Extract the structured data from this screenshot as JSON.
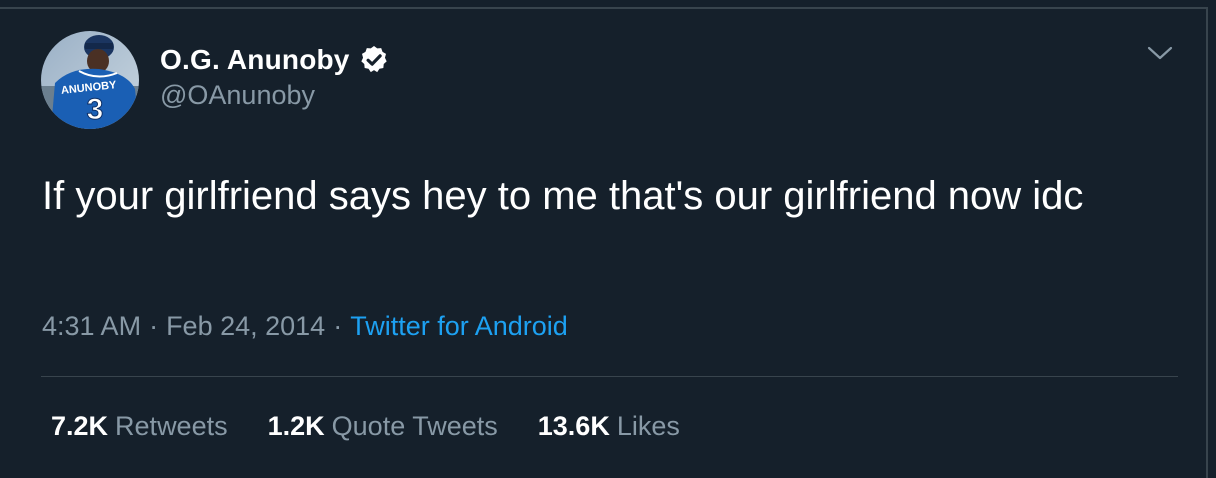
{
  "user": {
    "display_name": "O.G. Anunoby",
    "handle": "@OAnunoby",
    "verified": true,
    "avatar_jersey_name": "ANUNOBY",
    "avatar_jersey_number": "3"
  },
  "tweet": {
    "text": "If your girlfriend says hey to me that's our girlfriend now idc",
    "time": "4:31 AM",
    "date": "Feb 24, 2014",
    "separator": "·",
    "source": "Twitter for Android"
  },
  "stats": {
    "retweets_count": "7.2K",
    "retweets_label": "Retweets",
    "quotes_count": "1.2K",
    "quotes_label": "Quote Tweets",
    "likes_count": "13.6K",
    "likes_label": "Likes"
  },
  "colors": {
    "background": "#15202b",
    "secondary_text": "#8899a6",
    "link": "#1da1f2",
    "border": "#38444d"
  },
  "icons": {
    "verified": "verified-badge-icon",
    "menu": "chevron-down-icon"
  }
}
